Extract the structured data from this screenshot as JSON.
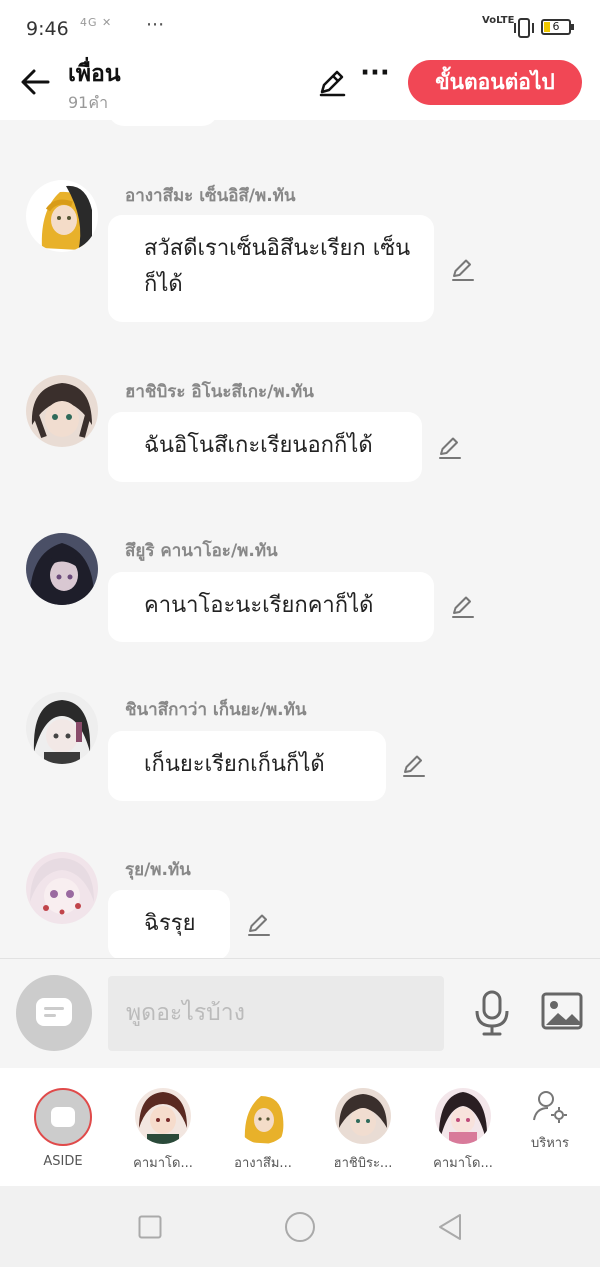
{
  "status": {
    "time": "9:46",
    "signal": "4G ✕",
    "dots": "···",
    "volte": "VoLTE",
    "battery": "6"
  },
  "header": {
    "title": "เพื่อน",
    "subtitle": "91คำ",
    "next_label": "ขั้นตอนต่อไป"
  },
  "messages": [
    {
      "sender": "อางาสึมะ เซ็นอิสึ/พ.ทัน",
      "text": "สวัสดีเราเซ็นอิสึนะเรียก เซ็นก็ได้"
    },
    {
      "sender": "ฮาชิบิระ อิโนะสึเกะ/พ.ทัน",
      "text": "ฉันอิโนสึเกะเรียนอกก็ได้"
    },
    {
      "sender": "สึยูริ คานาโอะ/พ.ทัน",
      "text": "คานาโอะนะเรียกคาก็ได้"
    },
    {
      "sender": "ชินาสึกาว่า เก็นยะ/พ.ทัน",
      "text": "เก็นยะเรียกเก็นก็ได้"
    },
    {
      "sender": "รุย/พ.ทัน",
      "text": "ฉิรรุย"
    }
  ],
  "input": {
    "placeholder": "พูดอะไรบ้าง"
  },
  "characters": [
    {
      "label": "ASIDE"
    },
    {
      "label": "คามาโด..."
    },
    {
      "label": "อางาสึม..."
    },
    {
      "label": "ฮาชิบิระ..."
    },
    {
      "label": "คามาโด..."
    }
  ],
  "admin_label": "บริหาร",
  "colors": {
    "accent": "#f14755",
    "background": "#f5f5f5",
    "bubble": "#ffffff"
  }
}
